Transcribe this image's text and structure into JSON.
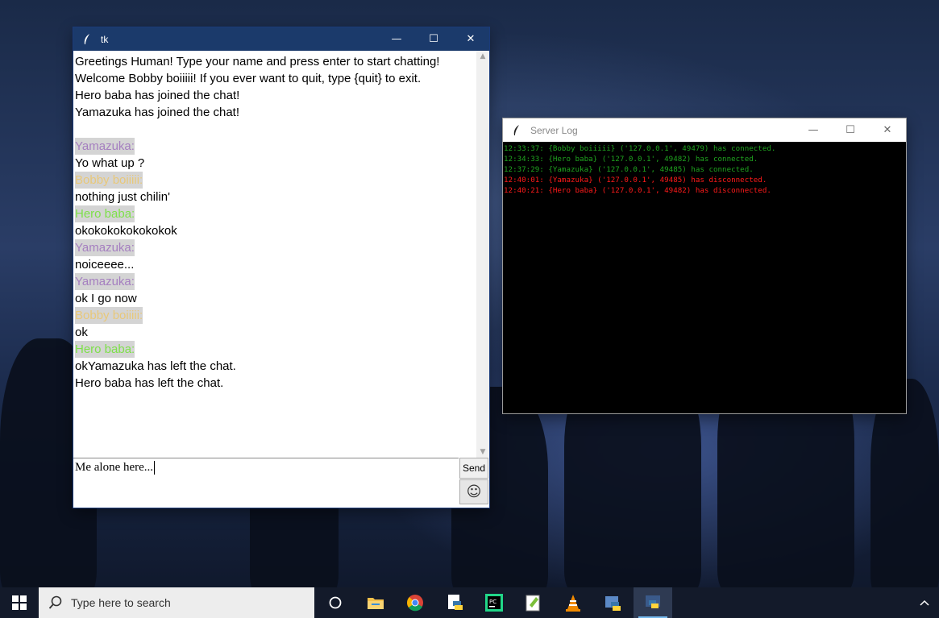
{
  "chat_window": {
    "title": "tk",
    "lines": [
      {
        "text": "Greetings Human! Type your name and press enter to start chatting!",
        "kind": "system"
      },
      {
        "text": "Welcome Bobby boiiiii! If you ever want to quit, type {quit} to exit.",
        "kind": "system"
      },
      {
        "text": "Hero baba has joined the chat!",
        "kind": "system"
      },
      {
        "text": "Yamazuka has joined the chat!",
        "kind": "system"
      },
      {
        "text": "",
        "kind": "blank"
      },
      {
        "text": "Yamazuka:",
        "kind": "name",
        "color": "#a57fc0"
      },
      {
        "text": "Yo what up ?",
        "kind": "message"
      },
      {
        "text": "Bobby boiiiii:",
        "kind": "name",
        "color": "#e8c87a"
      },
      {
        "text": "nothing just chilin'",
        "kind": "message"
      },
      {
        "text": "Hero baba:",
        "kind": "name",
        "color": "#7ee04a"
      },
      {
        "text": "okokokokokokokok",
        "kind": "message"
      },
      {
        "text": "Yamazuka:",
        "kind": "name",
        "color": "#a57fc0"
      },
      {
        "text": "noiceeee...",
        "kind": "message"
      },
      {
        "text": "Yamazuka:",
        "kind": "name",
        "color": "#a57fc0"
      },
      {
        "text": "ok I go now",
        "kind": "message"
      },
      {
        "text": "Bobby boiiiii:",
        "kind": "name",
        "color": "#e8c87a"
      },
      {
        "text": "ok",
        "kind": "message"
      },
      {
        "text": "Hero baba:",
        "kind": "name",
        "color": "#7ee04a"
      },
      {
        "text": "okYamazuka has left the chat.",
        "kind": "message"
      },
      {
        "text": "Hero baba has left the chat.",
        "kind": "message"
      }
    ],
    "input_value": "Me alone here...",
    "send_label": "Send",
    "emoji_glyph": "☺"
  },
  "server_log": {
    "title": "Server Log",
    "entries": [
      {
        "text": "12:33:37: {Bobby boiiiii} ('127.0.0.1', 49479) has connected.",
        "color": "#1fa31f"
      },
      {
        "text": "12:34:33: {Hero baba} ('127.0.0.1', 49482) has connected.",
        "color": "#1fa31f"
      },
      {
        "text": "12:37:29: {Yamazuka} ('127.0.0.1', 49485) has connected.",
        "color": "#1fa31f"
      },
      {
        "text": "12:40:01: {Yamazuka} ('127.0.0.1', 49485) has disconnected.",
        "color": "#ff1a1a"
      },
      {
        "text": "12:40:21: {Hero baba} ('127.0.0.1', 49482) has disconnected.",
        "color": "#ff1a1a"
      }
    ]
  },
  "window_controls": {
    "minimize": "—",
    "maximize": "☐",
    "close": "✕"
  },
  "taskbar": {
    "search_placeholder": "Type here to search",
    "apps": [
      "task-view",
      "file-explorer",
      "chrome",
      "python-idle",
      "pycharm",
      "notepad-plus-plus",
      "vlc",
      "python-launcher",
      "python"
    ]
  },
  "colors": {
    "tk_titlebar": "#1b3a6b",
    "name_highlight": "#d4d4d4",
    "log_bg": "#000000"
  }
}
